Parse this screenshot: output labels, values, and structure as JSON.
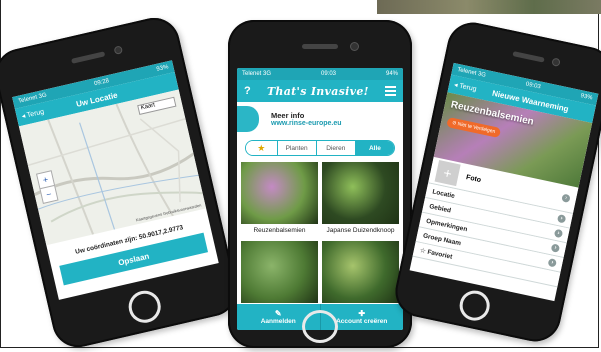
{
  "left_phone": {
    "status": {
      "carrier": "Telenet 3G",
      "time": "09:28",
      "battery": "93%"
    },
    "nav": {
      "back_label": "Terug",
      "title": "Uw Locatie"
    },
    "map": {
      "type_select": "Kaart",
      "zoom_in": "+",
      "zoom_out": "−",
      "attribution": "Kaartgegevens  Gebruiksvoorwaarden"
    },
    "coordinates_text": "Uw coördinaten zijn: 50.9017,2.9773",
    "save_label": "Opslaan"
  },
  "center_phone": {
    "status": {
      "carrier": "Telenet 3G",
      "time": "09:03",
      "battery": "94%"
    },
    "help_label": "?",
    "app_title": "That's Invasive!",
    "menu_icon": "hamburger-icon",
    "info": {
      "title": "Meer info",
      "link": "www.rinse-europe.eu"
    },
    "tabs": [
      {
        "label": "★",
        "icon": "star-icon"
      },
      {
        "label": "Planten"
      },
      {
        "label": "Dieren"
      },
      {
        "label": "Alle"
      }
    ],
    "species": [
      {
        "label": "Reuzenbalsemien",
        "color_a": "#6f9b47",
        "color_b": "#c48ac4"
      },
      {
        "label": "Japanse Duizendknoop",
        "color_a": "#2e4a22",
        "color_b": "#8fbf5a"
      },
      {
        "label": "",
        "color_a": "#4e7a34",
        "color_b": "#8bb46a"
      },
      {
        "label": "",
        "color_a": "#3f6a2c",
        "color_b": "#a6c46c"
      }
    ],
    "footer": {
      "left_label": "Aanmelden",
      "right_label": "Account creëren"
    }
  },
  "right_phone": {
    "status": {
      "carrier": "Telenet 3G",
      "time": "09:03",
      "battery": "93%"
    },
    "nav": {
      "back_label": "Terug",
      "title": "Nieuwe Waarneming"
    },
    "hero_title": "Reuzenbalsemien",
    "warning_label": "Niet te Verdelgen",
    "photo_label": "Foto",
    "rows": [
      {
        "label": "Locatie"
      },
      {
        "label": "Gebied"
      },
      {
        "label": "Opmerkingen"
      },
      {
        "label": "Groep Naam"
      },
      {
        "label": "Favoriet"
      }
    ]
  }
}
